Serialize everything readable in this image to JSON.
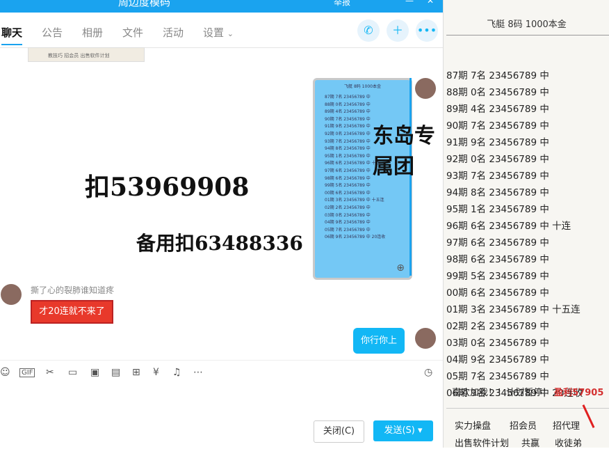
{
  "window": {
    "title": "周边度模码",
    "partial_label": "举报"
  },
  "tabs": [
    "聊天",
    "公告",
    "相册",
    "文件",
    "活动",
    "设置"
  ],
  "thumb_text": "教技巧  招会员  出售软件计划",
  "image_header": "飞艇  8码  1000本金",
  "watermarks": {
    "qq1": "扣53969908",
    "qq2": "备用扣63488336",
    "group": "东岛专属团"
  },
  "messages": {
    "sender_name": "撕了心的裂肺谁知道疼",
    "red": "才20连就不来了",
    "mine": "你行你上"
  },
  "buttons": {
    "close": "关闭(C)",
    "send": "发送(S)"
  },
  "right_panel": {
    "header": "飞艇   8码   1000本金",
    "rows": [
      "87期  7名  23456789 中",
      "88期  0名  23456789 中",
      "89期  4名  23456789 中",
      "90期  7名  23456789 中",
      "91期  9名  23456789 中",
      "92期  0名  23456789 中",
      "93期  7名  23456789 中",
      "94期  8名  23456789 中",
      "95期  1名  23456789 中",
      "96期  6名  23456789 中 十连",
      "97期  6名  23456789 中",
      "98期  6名  23456789 中",
      "99期  5名  23456789 中",
      "00期  6名  23456789 中",
      "01期  3名  23456789 中 十五连",
      "02期  2名  23456789 中",
      "03期  0名  23456789 中",
      "04期  9名  23456789 中",
      "05期  7名  23456789 中",
      "06期  9名  23456789 中 20连收"
    ],
    "footer": "喜欢加我！！计划暂停！",
    "profit": "盈利57905",
    "links": [
      "实力操盘",
      "招会员",
      "招代理",
      "出售软件计划",
      "共赢",
      "收徒弟"
    ]
  },
  "colors": {
    "accent": "#12b7f5",
    "red": "#e8392b",
    "profit": "#d43030"
  }
}
